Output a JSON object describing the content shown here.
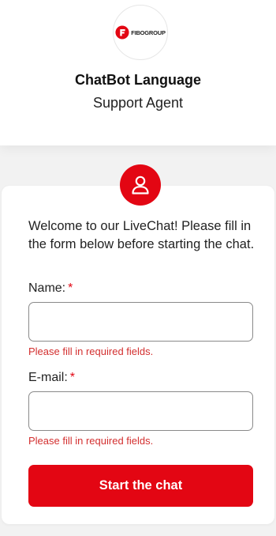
{
  "header": {
    "logo_text": "FIBOGROUP",
    "title": "ChatBot Language",
    "subtitle": "Support Agent"
  },
  "form": {
    "welcome_text": "Welcome to our LiveChat! Please fill in the form below before starting the chat.",
    "name_label": "Name:",
    "email_label": "E-mail:",
    "required_mark": "*",
    "name_value": "",
    "email_value": "",
    "name_error": "Please fill in required fields.",
    "email_error": "Please fill in required fields.",
    "submit_label": "Start the chat"
  },
  "icons": {
    "avatar": "user-icon",
    "logo": "fibogroup-logo"
  },
  "colors": {
    "accent": "#e30613",
    "error": "#d32f2f",
    "background": "#f2f2f2"
  }
}
